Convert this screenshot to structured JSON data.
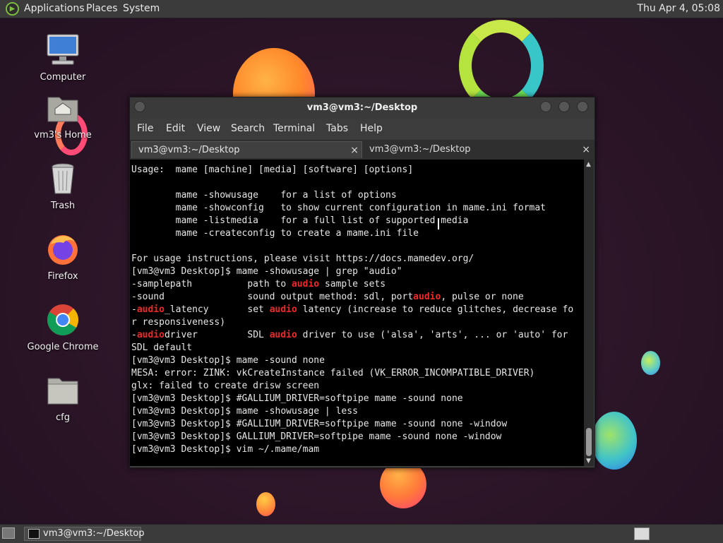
{
  "top_panel": {
    "applications": "Applications",
    "places": "Places",
    "system": "System",
    "clock": "Thu Apr  4, 05:08"
  },
  "desktop_icons": [
    {
      "label": "Computer"
    },
    {
      "label": "vm3's Home"
    },
    {
      "label": "Trash"
    },
    {
      "label": "Firefox"
    },
    {
      "label": "Google Chrome"
    },
    {
      "label": "cfg"
    }
  ],
  "terminal": {
    "title": "vm3@vm3:~/Desktop",
    "menu": [
      "File",
      "Edit",
      "View",
      "Search",
      "Terminal",
      "Tabs",
      "Help"
    ],
    "tabs": [
      {
        "label": "vm3@vm3:~/Desktop",
        "close": "×"
      },
      {
        "label": "vm3@vm3:~/Desktop",
        "close": "×"
      }
    ],
    "lines": [
      "Usage:  mame [machine] [media] [software] [options]",
      "",
      "        mame -showusage    for a list of options",
      "        mame -showconfig   to show current configuration in mame.ini format",
      "        mame -listmedia    for a full list of supported media",
      "        mame -createconfig to create a mame.ini file",
      "",
      "For usage instructions, please visit https://docs.mamedev.org/",
      "[vm3@vm3 Desktop]$ mame -showusage | grep \"audio\""
    ],
    "grep_lines": [
      {
        "pre": "-samplepath          path to ",
        "hl": "audio",
        "post": " sample sets"
      },
      {
        "pre": "-sound               sound output method: sdl, port",
        "hl": "audio",
        "post": ", pulse or none"
      },
      {
        "pre": "-",
        "hl": "audio",
        "post": "_latency       set ",
        "hl2": "audio",
        "post2": " latency (increase to reduce glitches, decrease fo"
      },
      {
        "pre": "r responsiveness)",
        "hl": "",
        "post": ""
      },
      {
        "pre": "-",
        "hl": "audio",
        "post": "driver         SDL ",
        "hl2": "audio",
        "post2": " driver to use ('alsa', 'arts', ... or 'auto' for"
      },
      {
        "pre": "SDL default",
        "hl": "",
        "post": ""
      }
    ],
    "tail_lines": [
      "[vm3@vm3 Desktop]$ mame -sound none",
      "MESA: error: ZINK: vkCreateInstance failed (VK_ERROR_INCOMPATIBLE_DRIVER)",
      "glx: failed to create drisw screen",
      "[vm3@vm3 Desktop]$ #GALLIUM_DRIVER=softpipe mame -sound none",
      "[vm3@vm3 Desktop]$ mame -showusage | less",
      "[vm3@vm3 Desktop]$ #GALLIUM_DRIVER=softpipe mame -sound none -window",
      "[vm3@vm3 Desktop]$ GALLIUM_DRIVER=softpipe mame -sound none -window",
      "[vm3@vm3 Desktop]$ vim ~/.mame/mam"
    ]
  },
  "taskbar": {
    "task_label": "vm3@vm3:~/Desktop"
  },
  "colors": {
    "highlight": "#ef2929",
    "terminal_bg": "#000000"
  }
}
